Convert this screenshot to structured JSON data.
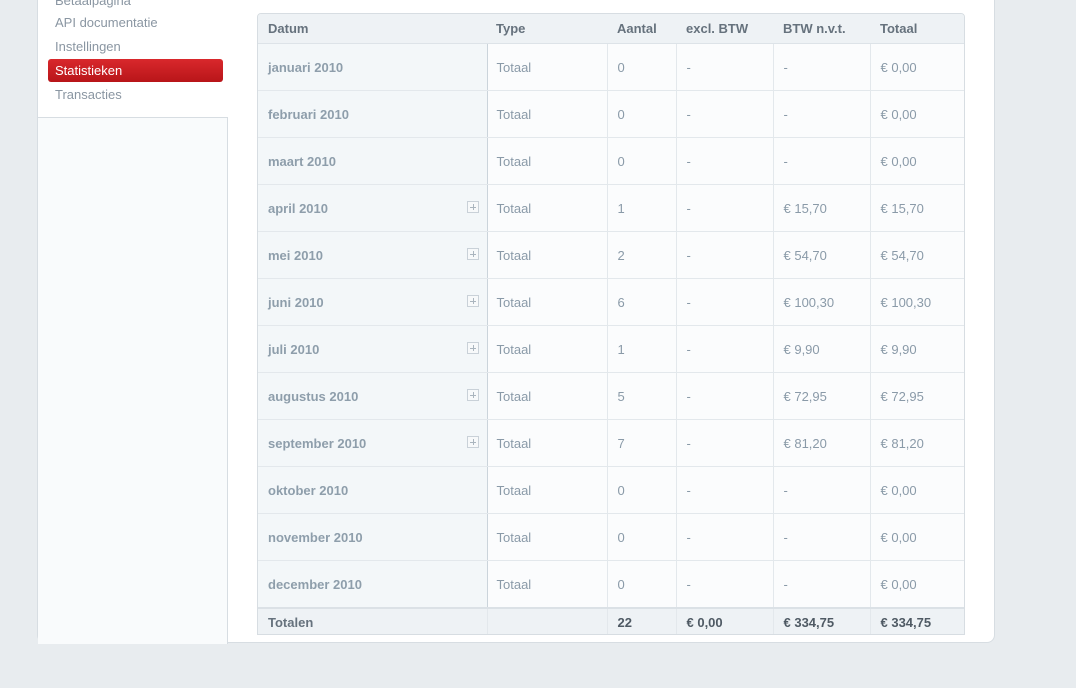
{
  "sidebar": {
    "items": [
      {
        "label": "Betaalpagina"
      },
      {
        "label": "API documentatie"
      },
      {
        "label": "Instellingen"
      },
      {
        "label": "Statistieken",
        "active": true
      },
      {
        "label": "Transacties"
      }
    ]
  },
  "colors": {
    "active_item": "#c81d22",
    "background": "#e8ecef"
  },
  "table": {
    "headers": [
      "Datum",
      "Type",
      "Aantal",
      "excl. BTW",
      "BTW n.v.t.",
      "Totaal"
    ],
    "rows": [
      {
        "datum": "januari 2010",
        "type": "Totaal",
        "aantal": "0",
        "excl": "-",
        "nvt": "-",
        "totaal": "€ 0,00",
        "expandable": false
      },
      {
        "datum": "februari 2010",
        "type": "Totaal",
        "aantal": "0",
        "excl": "-",
        "nvt": "-",
        "totaal": "€ 0,00",
        "expandable": false
      },
      {
        "datum": "maart 2010",
        "type": "Totaal",
        "aantal": "0",
        "excl": "-",
        "nvt": "-",
        "totaal": "€ 0,00",
        "expandable": false
      },
      {
        "datum": "april 2010",
        "type": "Totaal",
        "aantal": "1",
        "excl": "-",
        "nvt": "€ 15,70",
        "totaal": "€ 15,70",
        "expandable": true
      },
      {
        "datum": "mei 2010",
        "type": "Totaal",
        "aantal": "2",
        "excl": "-",
        "nvt": "€ 54,70",
        "totaal": "€ 54,70",
        "expandable": true
      },
      {
        "datum": "juni 2010",
        "type": "Totaal",
        "aantal": "6",
        "excl": "-",
        "nvt": "€ 100,30",
        "totaal": "€ 100,30",
        "expandable": true
      },
      {
        "datum": "juli 2010",
        "type": "Totaal",
        "aantal": "1",
        "excl": "-",
        "nvt": "€ 9,90",
        "totaal": "€ 9,90",
        "expandable": true
      },
      {
        "datum": "augustus 2010",
        "type": "Totaal",
        "aantal": "5",
        "excl": "-",
        "nvt": "€ 72,95",
        "totaal": "€ 72,95",
        "expandable": true
      },
      {
        "datum": "september 2010",
        "type": "Totaal",
        "aantal": "7",
        "excl": "-",
        "nvt": "€ 81,20",
        "totaal": "€ 81,20",
        "expandable": true
      },
      {
        "datum": "oktober 2010",
        "type": "Totaal",
        "aantal": "0",
        "excl": "-",
        "nvt": "-",
        "totaal": "€ 0,00",
        "expandable": false
      },
      {
        "datum": "november 2010",
        "type": "Totaal",
        "aantal": "0",
        "excl": "-",
        "nvt": "-",
        "totaal": "€ 0,00",
        "expandable": false
      },
      {
        "datum": "december 2010",
        "type": "Totaal",
        "aantal": "0",
        "excl": "-",
        "nvt": "-",
        "totaal": "€ 0,00",
        "expandable": false
      }
    ],
    "totals": {
      "label": "Totalen",
      "type": "",
      "aantal": "22",
      "excl": "€ 0,00",
      "nvt": "€ 334,75",
      "totaal": "€ 334,75"
    }
  }
}
